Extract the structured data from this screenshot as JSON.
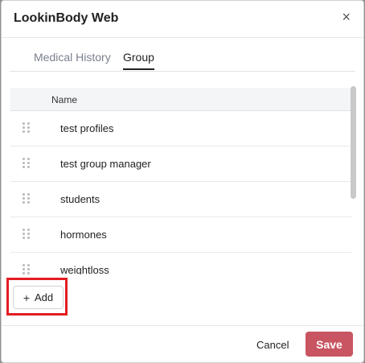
{
  "dialog": {
    "title": "LookinBody Web",
    "close_symbol": "×"
  },
  "tabs": [
    {
      "label": "Medical History",
      "active": false
    },
    {
      "label": "Group",
      "active": true
    }
  ],
  "table": {
    "header": "Name",
    "rows": [
      "test profiles",
      "test group manager",
      "students",
      "hormones",
      "weightloss"
    ]
  },
  "add_button": {
    "icon": "plus-icon",
    "label": "Add",
    "highlight_color": "#e31d23"
  },
  "footer": {
    "cancel": "Cancel",
    "save": "Save",
    "save_color": "#c85561"
  }
}
